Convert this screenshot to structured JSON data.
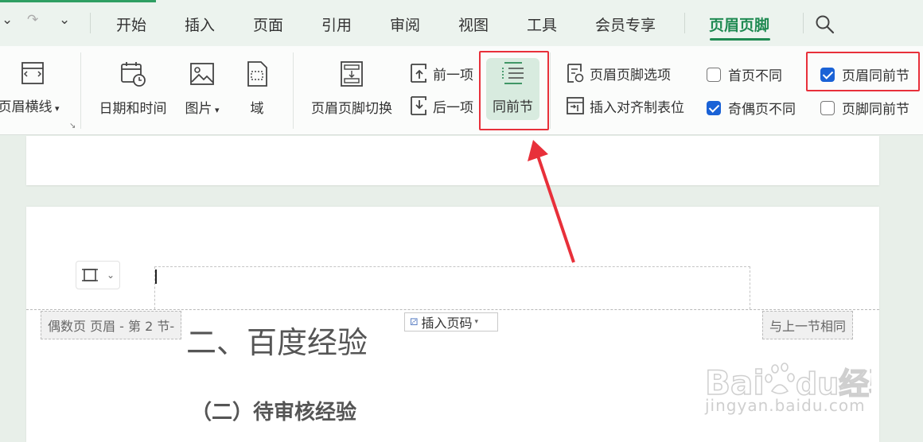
{
  "tabs": [
    {
      "label": "开始"
    },
    {
      "label": "插入"
    },
    {
      "label": "页面"
    },
    {
      "label": "引用"
    },
    {
      "label": "审阅"
    },
    {
      "label": "视图"
    },
    {
      "label": "工具"
    },
    {
      "label": "会员专享"
    },
    {
      "label": "页眉页脚",
      "active": true
    }
  ],
  "ribbon": {
    "header_line": "页眉横线",
    "date_time": "日期和时间",
    "picture": "图片",
    "field": "域",
    "hf_switch": "页眉页脚切换",
    "prev_item": "前一项",
    "next_item": "后一项",
    "same_as_prev": "同前节",
    "hf_options": "页眉页脚选项",
    "insert_align_tab": "插入对齐制表位",
    "first_page_diff": {
      "label": "首页不同",
      "checked": false
    },
    "odd_even_diff": {
      "label": "奇偶页不同",
      "checked": true
    },
    "header_same_prev": {
      "label": "页眉同前节",
      "checked": true
    },
    "footer_same_prev": {
      "label": "页脚同前节",
      "checked": false
    }
  },
  "document": {
    "header_tag": "偶数页 页眉  - 第 2 节-",
    "insert_page_number": "插入页码",
    "same_as_previous_tag": "与上一节相同",
    "heading1": "二、百度经验",
    "heading2": "（二）待审核经验"
  },
  "watermark": {
    "logo": "Baidu经验",
    "url": "jingyan.baidu.com"
  },
  "colors": {
    "accent": "#1f8a52",
    "highlight": "#e8303a",
    "checkbox": "#1a62d6"
  }
}
